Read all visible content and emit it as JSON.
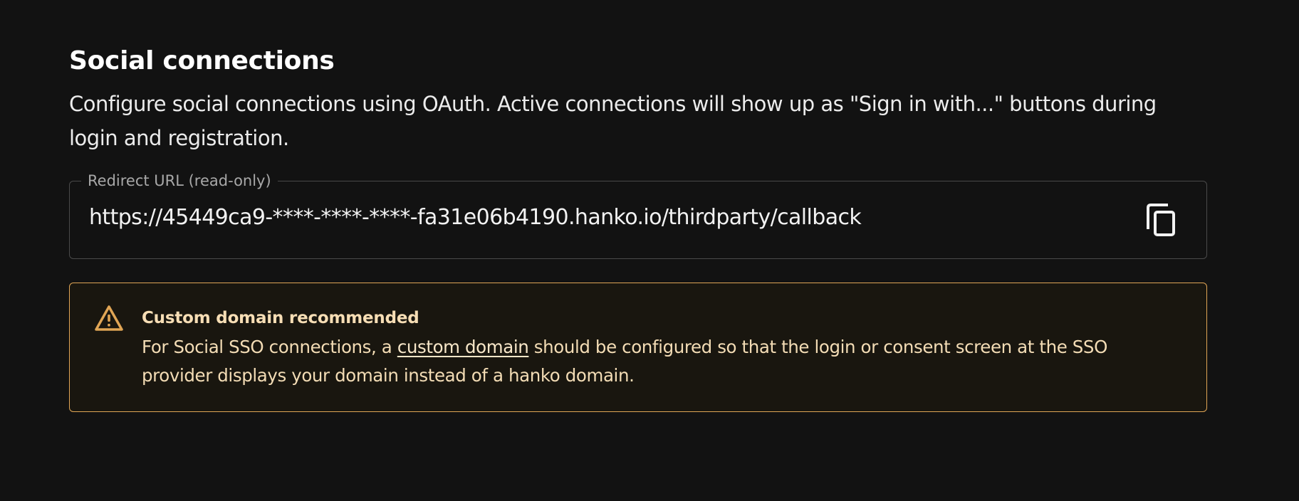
{
  "section": {
    "title": "Social connections",
    "description": "Configure social connections using OAuth. Active connections will show up as \"Sign in with...\" buttons during login and registration."
  },
  "redirect_field": {
    "label": "Redirect URL (read-only)",
    "value": "https://45449ca9-****-****-****-fa31e06b4190.hanko.io/thirdparty/callback",
    "copy_icon": "copy-icon"
  },
  "alert": {
    "icon": "warning-triangle-icon",
    "title": "Custom domain recommended",
    "text_before": "For Social SSO connections, a ",
    "link_text": "custom domain",
    "text_after": " should be configured so that the login or consent screen at the SSO provider displays your domain instead of a hanko domain.",
    "border_color": "#e0a555",
    "text_color": "#f3dcb5"
  }
}
